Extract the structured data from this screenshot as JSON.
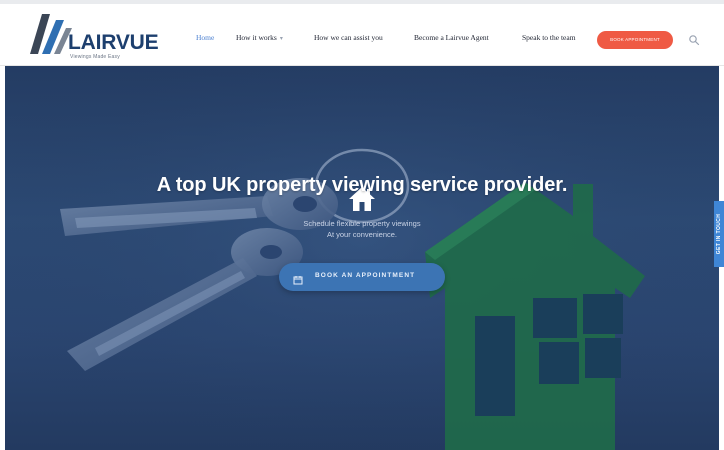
{
  "brand": {
    "name": "LAIRVUE",
    "tagline": "Viewings Made Easy"
  },
  "nav": {
    "items": [
      {
        "label": "Home",
        "active": true
      },
      {
        "label": "How it works",
        "has_dropdown": true
      },
      {
        "label": "How we can assist you"
      },
      {
        "label": "Become a Lairvue Agent"
      },
      {
        "label": "Speak to the team"
      }
    ],
    "cta_label": "Book appointment",
    "search_icon": "search-icon"
  },
  "hero": {
    "icon": "home-icon",
    "headline": "A top UK property viewing service provider.",
    "subline_1": "Schedule flexible property viewings",
    "subline_2": "At your convenience.",
    "button_label": "Book an appointment",
    "button_icon": "calendar-icon"
  },
  "side_tab": {
    "label": "Get in touch"
  },
  "colors": {
    "brand_navy": "#1d3f6e",
    "nav_active": "#4a7fd0",
    "cta": "#ef5a44",
    "hero_bg": "#2a4570",
    "button_blue": "#3c74b4",
    "side_tab": "#3f86d6",
    "house_green": "#1f6a4a"
  }
}
